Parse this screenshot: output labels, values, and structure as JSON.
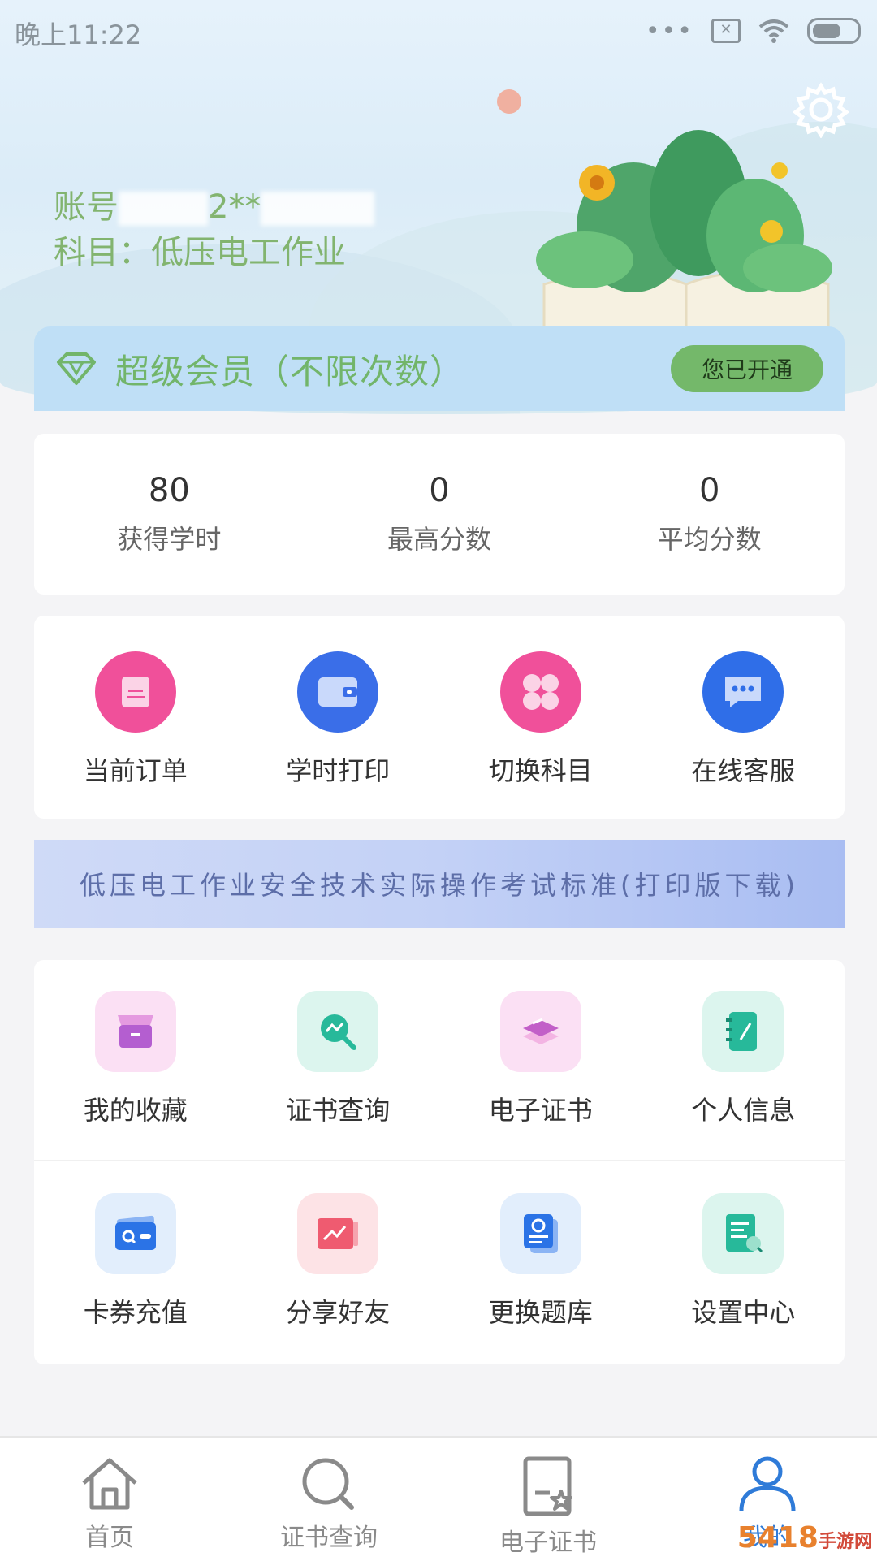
{
  "status_bar": {
    "time": "晚上11:22",
    "dots": "•••"
  },
  "header": {
    "account_label": "账号",
    "account_visible": "2**",
    "subject_line": "科目：低压电工作业"
  },
  "vip": {
    "title": "超级会员（不限次数）",
    "button_label": "您已开通"
  },
  "stats": [
    {
      "value": "80",
      "label": "获得学时"
    },
    {
      "value": "0",
      "label": "最高分数"
    },
    {
      "value": "0",
      "label": "平均分数"
    }
  ],
  "quick_actions": [
    {
      "label": "当前订单",
      "icon": "order-icon",
      "color": "#f0509a"
    },
    {
      "label": "学时打印",
      "icon": "wallet-icon",
      "color": "#3a6ee8"
    },
    {
      "label": "切换科目",
      "icon": "grid-icon",
      "color": "#f0509a"
    },
    {
      "label": "在线客服",
      "icon": "chat-icon",
      "color": "#2f6ee8"
    }
  ],
  "banner": {
    "text": "低压电工作业安全技术实际操作考试标准(打印版下载)"
  },
  "menu_row1": [
    {
      "label": "我的收藏",
      "icon": "store-icon"
    },
    {
      "label": "证书查询",
      "icon": "search-chart-icon"
    },
    {
      "label": "电子证书",
      "icon": "book-stack-icon"
    },
    {
      "label": "个人信息",
      "icon": "notebook-icon"
    }
  ],
  "menu_row2": [
    {
      "label": "卡券充值",
      "icon": "card-icon"
    },
    {
      "label": "分享好友",
      "icon": "share-chart-icon"
    },
    {
      "label": "更换题库",
      "icon": "refresh-doc-icon"
    },
    {
      "label": "设置中心",
      "icon": "settings-doc-icon"
    }
  ],
  "tabs": [
    {
      "label": "首页",
      "icon": "home-icon",
      "active": false
    },
    {
      "label": "证书查询",
      "icon": "search-icon",
      "active": false
    },
    {
      "label": "电子证书",
      "icon": "certificate-icon",
      "active": false
    },
    {
      "label": "我的",
      "icon": "user-icon",
      "active": true
    }
  ],
  "watermark": {
    "text": "5418",
    "sub": "手游网"
  },
  "colors": {
    "accent_green": "#74b86a",
    "tab_active": "#2f7bd8",
    "text_green": "#82b46f"
  }
}
